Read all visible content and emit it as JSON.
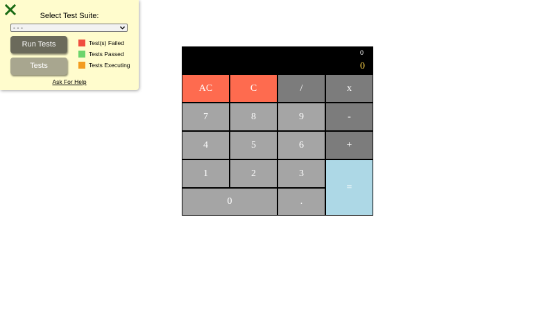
{
  "panel": {
    "title": "Select Test Suite:",
    "suite_select": {
      "value": "- - -"
    },
    "run_button": "Run Tests",
    "tests_button": "Tests",
    "legend": [
      {
        "label": "Test(s) Failed",
        "color": "#f04e3e"
      },
      {
        "label": "Tests Passed",
        "color": "#6cd46c"
      },
      {
        "label": "Tests Executing",
        "color": "#f39c1f"
      }
    ],
    "help_link": "Ask For Help"
  },
  "calculator": {
    "display_secondary": "0",
    "display_main": "0",
    "keys": {
      "ac": "AC",
      "c": "C",
      "divide": "/",
      "multiply": "x",
      "seven": "7",
      "eight": "8",
      "nine": "9",
      "minus": "-",
      "four": "4",
      "five": "5",
      "six": "6",
      "plus": "+",
      "one": "1",
      "two": "2",
      "three": "3",
      "equals": "=",
      "zero": "0",
      "decimal": "."
    }
  }
}
